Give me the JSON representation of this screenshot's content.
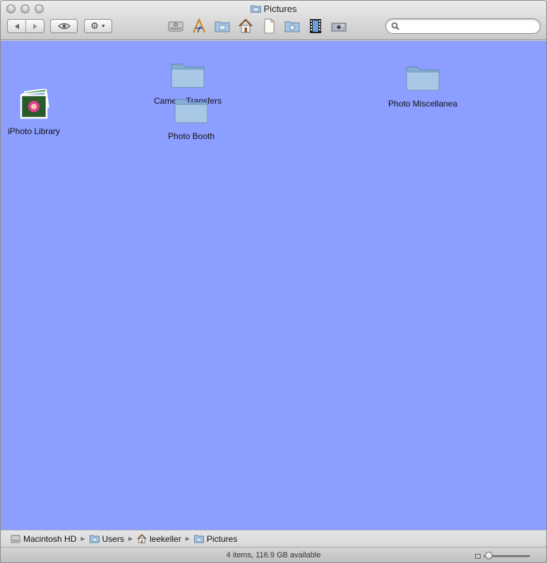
{
  "window": {
    "title": "Pictures"
  },
  "toolbar": {
    "back_icon": "back-arrow-icon",
    "forward_icon": "forward-arrow-icon",
    "quicklook_icon": "eye-icon",
    "action_icon": "gear-icon",
    "shortcuts": [
      {
        "name": "macintosh-hd-icon"
      },
      {
        "name": "applications-icon"
      },
      {
        "name": "pictures-folder-icon"
      },
      {
        "name": "home-icon"
      },
      {
        "name": "document-icon"
      },
      {
        "name": "public-folder-icon"
      },
      {
        "name": "movies-icon"
      },
      {
        "name": "camera-icon"
      }
    ],
    "search": {
      "value": "",
      "placeholder": ""
    }
  },
  "content": {
    "background": "#8c9eff",
    "items": [
      {
        "label": "iPhoto Library",
        "icon": "iphoto-library-icon"
      },
      {
        "label": "Camera Transfers",
        "icon": "folder-icon"
      },
      {
        "label": "Photo Booth",
        "icon": "folder-icon"
      },
      {
        "label": "Photo Miscellanea",
        "icon": "folder-icon"
      }
    ]
  },
  "pathbar": {
    "crumbs": [
      {
        "label": "Macintosh HD",
        "icon": "hard-drive-icon"
      },
      {
        "label": "Users",
        "icon": "folder-icon"
      },
      {
        "label": "leekeller",
        "icon": "home-icon"
      },
      {
        "label": "Pictures",
        "icon": "pictures-folder-icon"
      }
    ]
  },
  "statusbar": {
    "text": "4 items, 116.9 GB available",
    "icon_size_level": 0.05
  }
}
